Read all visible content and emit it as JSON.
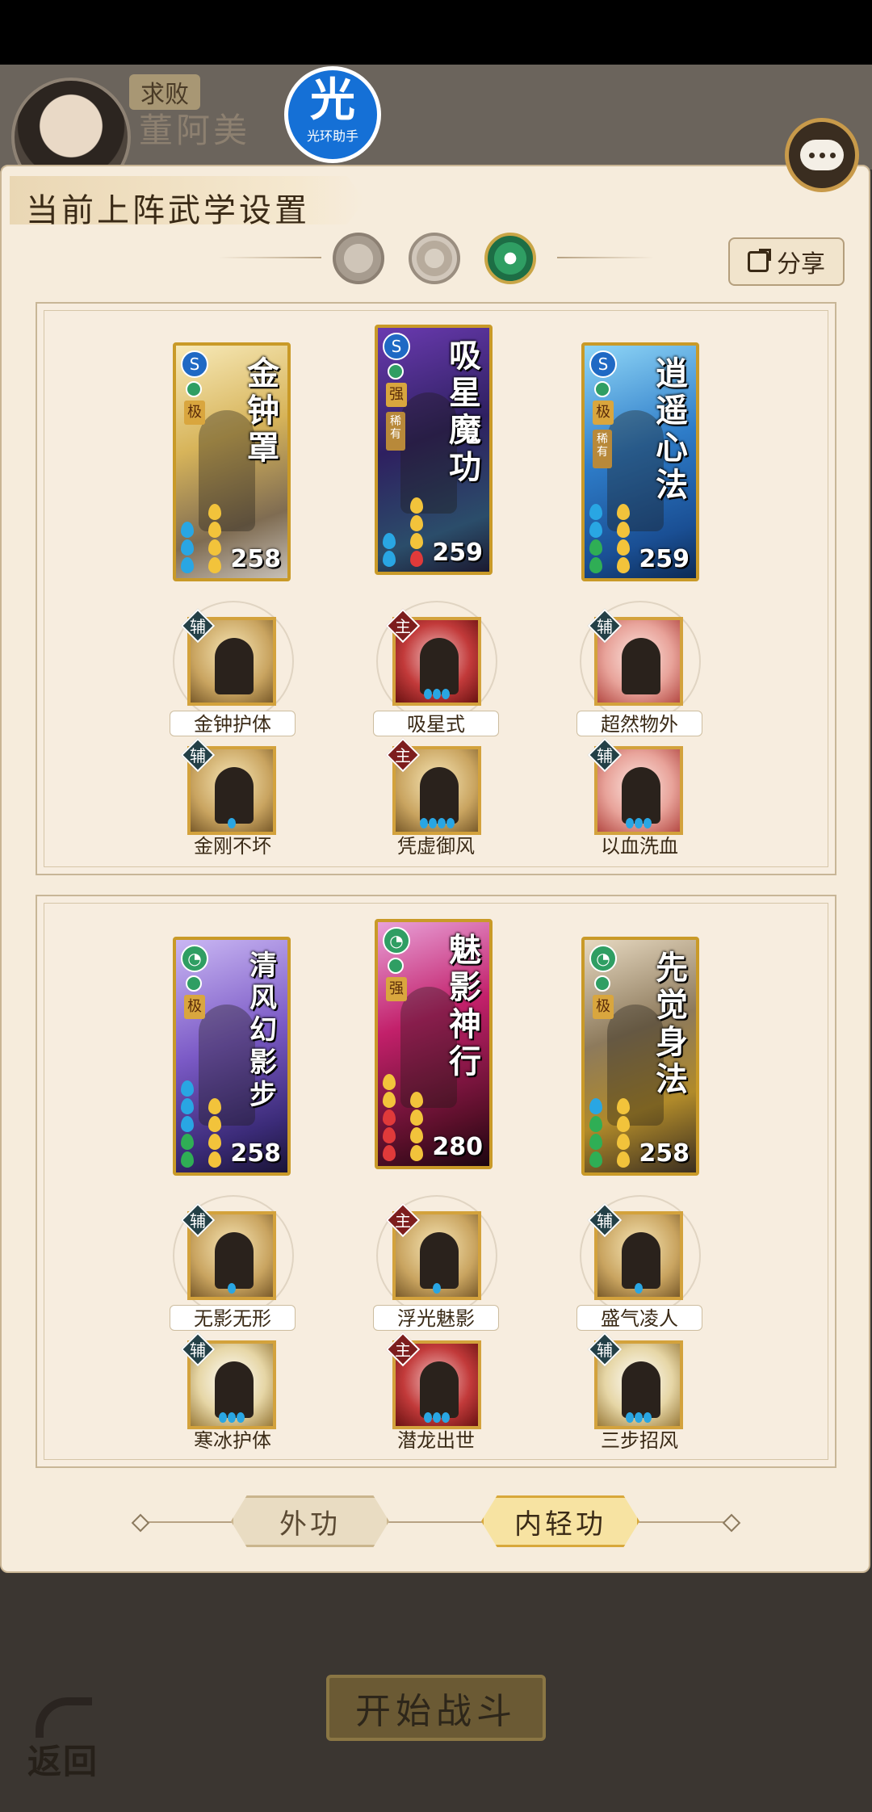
{
  "header": {
    "result_tag": "求败",
    "player_name": "董阿美",
    "assist_badge": {
      "glyph": "光",
      "label": "光环助手"
    }
  },
  "panel": {
    "title": "当前上阵武学设置",
    "share_label": "分享"
  },
  "groups": [
    {
      "cards": [
        {
          "title": "金钟罩",
          "power": "258",
          "rank": "极",
          "rarity": ""
        },
        {
          "title": "吸星魔功",
          "power": "259",
          "rank": "强",
          "rarity": "稀有"
        },
        {
          "title": "逍遥心法",
          "power": "259",
          "rank": "极",
          "rarity": "稀有"
        }
      ],
      "skills_row1": [
        {
          "type": "辅",
          "name": "金钟护体"
        },
        {
          "type": "主",
          "name": "吸星式"
        },
        {
          "type": "辅",
          "name": "超然物外"
        }
      ],
      "skills_row2": [
        {
          "type": "辅",
          "name": "金刚不坏"
        },
        {
          "type": "主",
          "name": "凭虚御风"
        },
        {
          "type": "辅",
          "name": "以血洗血"
        }
      ]
    },
    {
      "cards": [
        {
          "title": "清风幻影步",
          "power": "258",
          "rank": "极",
          "rarity": ""
        },
        {
          "title": "魅影神行",
          "power": "280",
          "rank": "强",
          "rarity": ""
        },
        {
          "title": "先觉身法",
          "power": "258",
          "rank": "极",
          "rarity": ""
        }
      ],
      "skills_row1": [
        {
          "type": "辅",
          "name": "无影无形"
        },
        {
          "type": "主",
          "name": "浮光魅影"
        },
        {
          "type": "辅",
          "name": "盛气凌人"
        }
      ],
      "skills_row2": [
        {
          "type": "辅",
          "name": "寒冰护体"
        },
        {
          "type": "主",
          "name": "潜龙出世"
        },
        {
          "type": "辅",
          "name": "三步招风"
        }
      ]
    }
  ],
  "rarity_small": "稀有",
  "categories": {
    "outer": "外功",
    "inner": "内轻功",
    "selected": "内轻功"
  },
  "footer": {
    "start_battle": "开始战斗",
    "back": "返回"
  },
  "colors": {
    "accent_gold": "#c99a28",
    "panel_bg": "#f6ecdc",
    "selected_tab": "#2f9e63"
  }
}
